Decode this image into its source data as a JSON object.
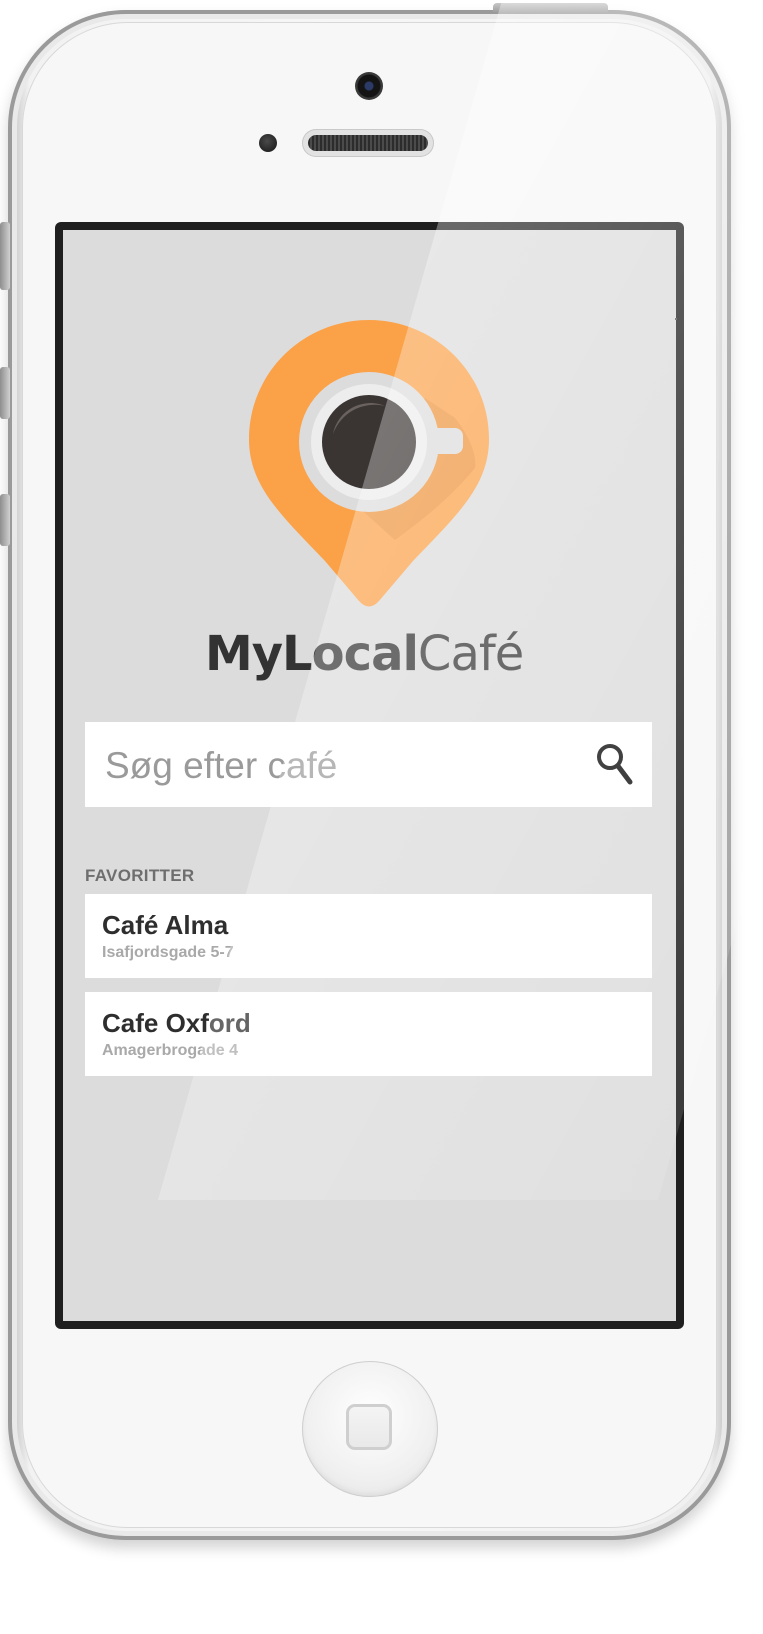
{
  "app": {
    "brand_bold": "MyLocal",
    "brand_light": "Café",
    "accent_color": "#FBA148",
    "cup_color": "#3A3533"
  },
  "search": {
    "placeholder": "Søg efter café",
    "icon": "search-icon"
  },
  "favorites": {
    "section_label": "FAVORITTER",
    "items": [
      {
        "name": "Café Alma",
        "address": "Isafjordsgade 5-7"
      },
      {
        "name": "Cafe Oxford",
        "address": "Amagerbrogade 4"
      }
    ]
  }
}
